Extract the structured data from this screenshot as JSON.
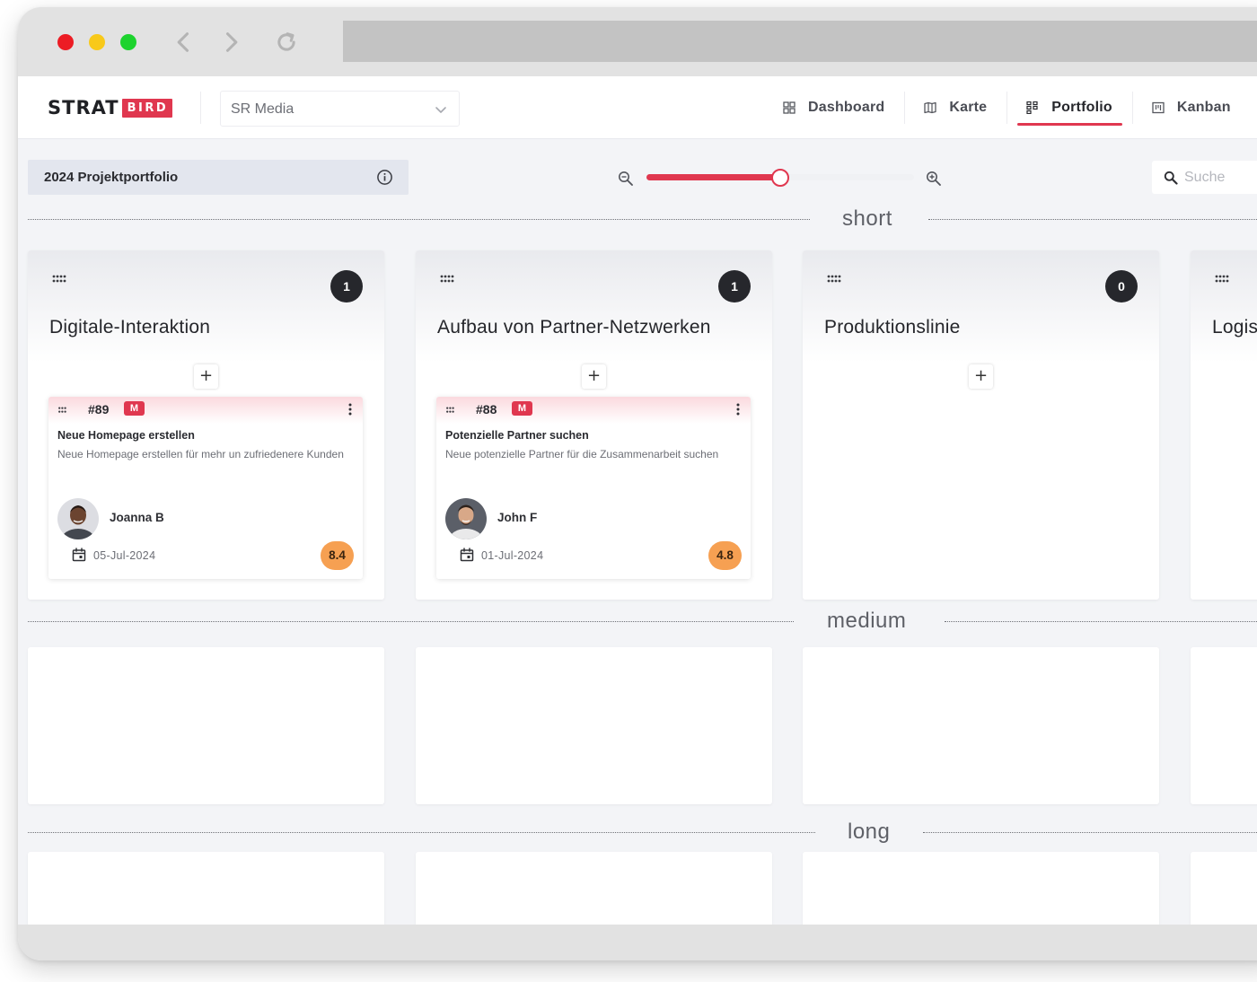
{
  "app": {
    "logo_text": "STRAT",
    "logo_badge": "BIRD",
    "organization": "SR Media"
  },
  "nav": {
    "tabs": [
      {
        "label": "Dashboard",
        "icon": "dashboard-icon",
        "active": false
      },
      {
        "label": "Karte",
        "icon": "map-icon",
        "active": false
      },
      {
        "label": "Portfolio",
        "icon": "portfolio-icon",
        "active": true
      },
      {
        "label": "Kanban",
        "icon": "kanban-icon",
        "active": false
      }
    ]
  },
  "toolbar": {
    "portfolio_title": "2024 Projektportfolio",
    "zoom_level": 0.5,
    "search_placeholder": "Suche"
  },
  "bands": {
    "short": "short",
    "medium": "medium",
    "long": "long"
  },
  "columns": [
    {
      "title": "Digitale-Interaktion",
      "count": "1",
      "card": {
        "id": "#89",
        "size": "M",
        "title": "Neue Homepage erstellen",
        "description": "Neue Homepage erstellen für mehr un zufriedenere Kunden",
        "assignee": "Joanna B",
        "due_date": "05-Jul-2024",
        "score": "8.4"
      }
    },
    {
      "title": "Aufbau von Partner-Netzwerken",
      "count": "1",
      "card": {
        "id": "#88",
        "size": "M",
        "title": "Potenzielle Partner suchen",
        "description": "Neue potenzielle Partner für die Zusammenarbeit suchen",
        "assignee": "John F",
        "due_date": "01-Jul-2024",
        "score": "4.8"
      }
    },
    {
      "title": "Produktionslinie",
      "count": "0"
    },
    {
      "title": "Logis"
    }
  ],
  "colors": {
    "accent": "#e0374f",
    "score": "#f6a052",
    "count_badge": "#26272c"
  }
}
